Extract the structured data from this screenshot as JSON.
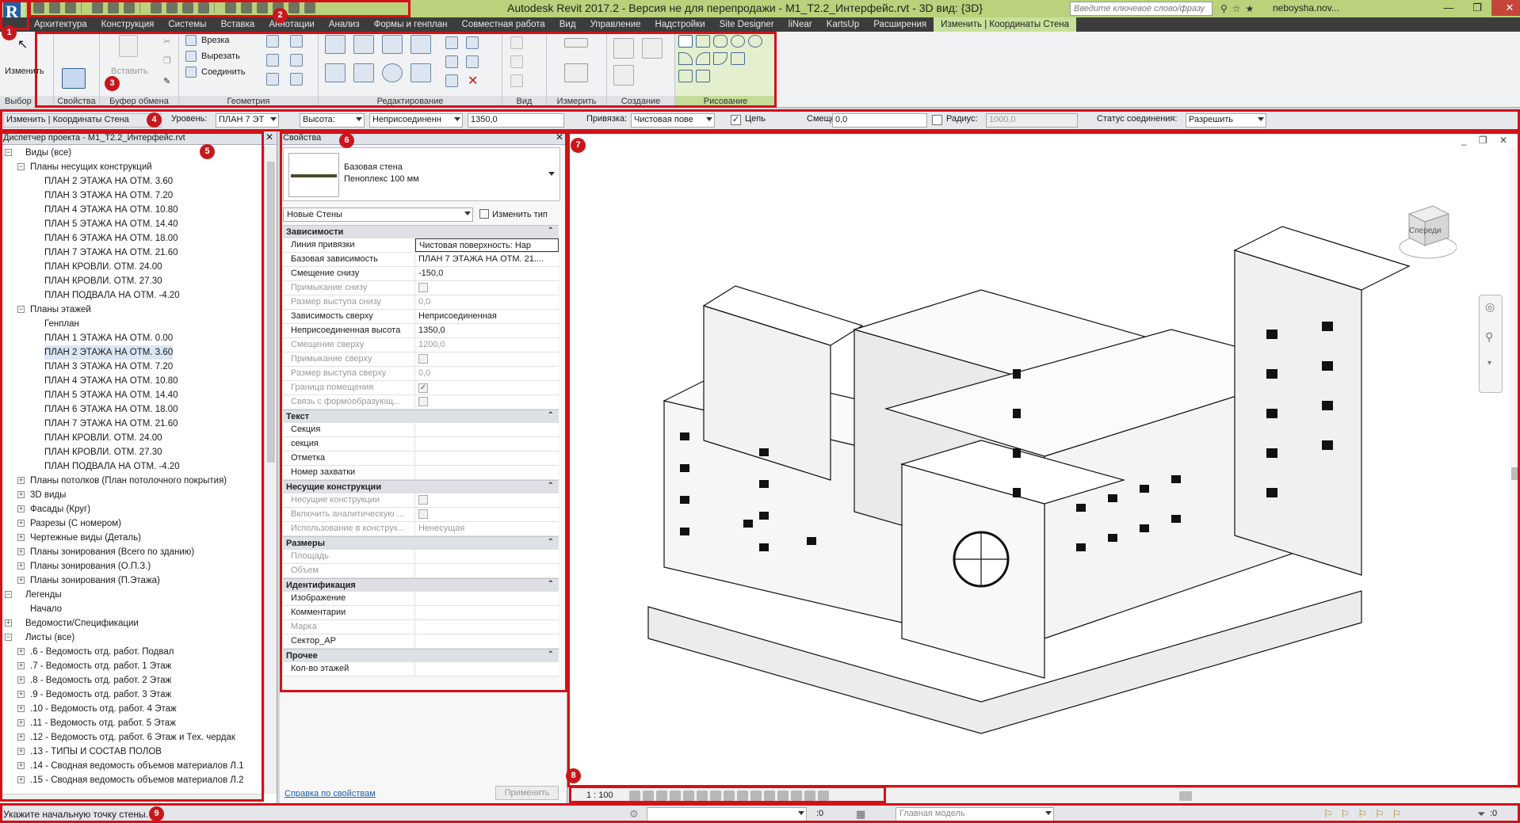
{
  "window": {
    "title": "Autodesk Revit 2017.2 - Версия не для перепродажи -     M1_T2.2_Интерфейс.rvt - 3D вид: {3D}",
    "search_placeholder": "Введите ключевое слово/фразу",
    "user": "neboysha.nov...",
    "min": "—",
    "restore": "❐",
    "close": "✕"
  },
  "ribbon_tabs": [
    "Архитектура",
    "Конструкция",
    "Системы",
    "Вставка",
    "Аннотации",
    "Анализ",
    "Формы и генплан",
    "Совместная работа",
    "Вид",
    "Управление",
    "Надстройки",
    "Site Designer",
    "liNear",
    "KartsUp",
    "Расширения",
    "Изменить | Координаты Стена"
  ],
  "ribbon_active_tab_index": 15,
  "ribbon": {
    "select_label": "Выбор",
    "modify_label": "Изменить",
    "properties_label": "Свойства",
    "clipboard_label": "Буфер обмена",
    "paste_label": "Вставить",
    "geometry_label": "Геометрия",
    "cut_in": "Врезка",
    "cut": "Вырезать",
    "join": "Соединить",
    "edit_label": "Редактирование",
    "view_label": "Вид",
    "measure_label": "Измерить",
    "create_label": "Создание",
    "draw_label": "Рисование"
  },
  "options_bar": {
    "context": "Изменить | Координаты Стена",
    "level_label": "Уровень:",
    "level_value": "ПЛАН 7 ЭТ",
    "height_label": "Высота:",
    "height_mode": "Неприсоединенн",
    "height_value": "1350,0",
    "anchor_label": "Привязка:",
    "anchor_value": "Чистовая пове",
    "chain_label": "Цепь",
    "chain_checked": "✓",
    "offset_label": "Смещение:",
    "offset_value": "0,0",
    "radius_label": "Радиус:",
    "radius_value": "1000,0",
    "join_status_label": "Статус соединения:",
    "join_status_value": "Разрешить"
  },
  "project_browser": {
    "title": "Диспетчер проекта - M1_T2.2_Интерфейс.rvt",
    "close": "✕",
    "nodes": [
      {
        "label": "Виды (все)",
        "depth": 0,
        "toggle": "−"
      },
      {
        "label": "Планы несущих конструкций",
        "depth": 1,
        "toggle": "−"
      },
      {
        "label": "ПЛАН 2 ЭТАЖА НА ОТМ. 3.60",
        "depth": 2,
        "toggle": ""
      },
      {
        "label": "ПЛАН 3 ЭТАЖА НА ОТМ. 7.20",
        "depth": 2,
        "toggle": ""
      },
      {
        "label": "ПЛАН 4 ЭТАЖА НА ОТМ. 10.80",
        "depth": 2,
        "toggle": ""
      },
      {
        "label": "ПЛАН 5 ЭТАЖА НА ОТМ. 14.40",
        "depth": 2,
        "toggle": ""
      },
      {
        "label": "ПЛАН 6 ЭТАЖА НА ОТМ. 18.00",
        "depth": 2,
        "toggle": ""
      },
      {
        "label": "ПЛАН 7 ЭТАЖА НА ОТМ. 21.60",
        "depth": 2,
        "toggle": ""
      },
      {
        "label": "ПЛАН КРОВЛИ. ОТМ. 24.00",
        "depth": 2,
        "toggle": ""
      },
      {
        "label": "ПЛАН КРОВЛИ. ОТМ. 27.30",
        "depth": 2,
        "toggle": ""
      },
      {
        "label": "ПЛАН ПОДВАЛА НА ОТМ. -4.20",
        "depth": 2,
        "toggle": ""
      },
      {
        "label": "Планы этажей",
        "depth": 1,
        "toggle": "−"
      },
      {
        "label": "Генплан",
        "depth": 2,
        "toggle": ""
      },
      {
        "label": "ПЛАН 1 ЭТАЖА НА ОТМ. 0.00",
        "depth": 2,
        "toggle": ""
      },
      {
        "label": "ПЛАН 2 ЭТАЖА НА ОТМ. 3.60",
        "depth": 2,
        "toggle": "",
        "selected": true
      },
      {
        "label": "ПЛАН 3 ЭТАЖА НА ОТМ. 7.20",
        "depth": 2,
        "toggle": ""
      },
      {
        "label": "ПЛАН 4 ЭТАЖА НА ОТМ. 10.80",
        "depth": 2,
        "toggle": ""
      },
      {
        "label": "ПЛАН 5 ЭТАЖА НА ОТМ. 14.40",
        "depth": 2,
        "toggle": ""
      },
      {
        "label": "ПЛАН 6 ЭТАЖА НА ОТМ. 18.00",
        "depth": 2,
        "toggle": ""
      },
      {
        "label": "ПЛАН 7 ЭТАЖА НА ОТМ. 21.60",
        "depth": 2,
        "toggle": ""
      },
      {
        "label": "ПЛАН КРОВЛИ. ОТМ. 24.00",
        "depth": 2,
        "toggle": ""
      },
      {
        "label": "ПЛАН КРОВЛИ. ОТМ. 27.30",
        "depth": 2,
        "toggle": ""
      },
      {
        "label": "ПЛАН ПОДВАЛА НА ОТМ. -4.20",
        "depth": 2,
        "toggle": ""
      },
      {
        "label": "Планы потолков (План потолочного покрытия)",
        "depth": 1,
        "toggle": "+"
      },
      {
        "label": "3D виды",
        "depth": 1,
        "toggle": "+"
      },
      {
        "label": "Фасады (Круг)",
        "depth": 1,
        "toggle": "+"
      },
      {
        "label": "Разрезы (С номером)",
        "depth": 1,
        "toggle": "+"
      },
      {
        "label": "Чертежные виды (Деталь)",
        "depth": 1,
        "toggle": "+"
      },
      {
        "label": "Планы зонирования (Всего по зданию)",
        "depth": 1,
        "toggle": "+"
      },
      {
        "label": "Планы зонирования (О.П.З.)",
        "depth": 1,
        "toggle": "+"
      },
      {
        "label": "Планы зонирования (П.Этажа)",
        "depth": 1,
        "toggle": "+"
      },
      {
        "label": "Легенды",
        "depth": 0,
        "toggle": "−"
      },
      {
        "label": "Начало",
        "depth": 1,
        "toggle": ""
      },
      {
        "label": "Ведомости/Спецификации",
        "depth": 0,
        "toggle": "+"
      },
      {
        "label": "Листы (все)",
        "depth": 0,
        "toggle": "−"
      },
      {
        "label": ".6 - Ведомость отд. работ. Подвал",
        "depth": 1,
        "toggle": "+"
      },
      {
        "label": ".7 - Ведомость отд. работ. 1 Этаж",
        "depth": 1,
        "toggle": "+"
      },
      {
        "label": ".8 - Ведомость отд. работ. 2 Этаж",
        "depth": 1,
        "toggle": "+"
      },
      {
        "label": ".9 - Ведомость отд. работ. 3 Этаж",
        "depth": 1,
        "toggle": "+"
      },
      {
        "label": ".10 - Ведомость отд. работ. 4 Этаж",
        "depth": 1,
        "toggle": "+"
      },
      {
        "label": ".11 - Ведомость отд. работ. 5 Этаж",
        "depth": 1,
        "toggle": "+"
      },
      {
        "label": ".12 - Ведомость отд. работ. 6 Этаж и Тех. чердак",
        "depth": 1,
        "toggle": "+"
      },
      {
        "label": ".13 - ТИПЫ И СОСТАВ ПОЛОВ",
        "depth": 1,
        "toggle": "+"
      },
      {
        "label": ".14 - Сводная ведомость объемов материалов Л.1",
        "depth": 1,
        "toggle": "+"
      },
      {
        "label": ".15 - Сводная ведомость объемов материалов Л.2",
        "depth": 1,
        "toggle": "+"
      }
    ]
  },
  "properties": {
    "title": "Свойства",
    "close": "✕",
    "type_family": "Базовая стена",
    "type_name": "Пеноплекс 100 мм",
    "filter_value": "Новые Стены",
    "edit_type": "Изменить тип",
    "groups": [
      {
        "name": "Зависимости",
        "rows": [
          {
            "k": "Линия привязки",
            "v": "Чистовая поверхность: Нар",
            "ro": false,
            "edit": true
          },
          {
            "k": "Базовая зависимость",
            "v": "ПЛАН 7 ЭТАЖА НА ОТМ. 21....",
            "ro": false
          },
          {
            "k": "Смещение снизу",
            "v": "-150,0",
            "ro": false
          },
          {
            "k": "Примыкание снизу",
            "v": "",
            "ro": true,
            "cb": ""
          },
          {
            "k": "Размер выступа снизу",
            "v": "0,0",
            "ro": true
          },
          {
            "k": "Зависимость сверху",
            "v": "Неприсоединенная",
            "ro": false
          },
          {
            "k": "Неприсоединенная высота",
            "v": "1350,0",
            "ro": false
          },
          {
            "k": "Смещение сверху",
            "v": "1200,0",
            "ro": true
          },
          {
            "k": "Примыкание сверху",
            "v": "",
            "ro": true,
            "cb": ""
          },
          {
            "k": "Размер выступа сверху",
            "v": "0,0",
            "ro": true
          },
          {
            "k": "Граница помещения",
            "v": "",
            "ro": true,
            "cb": "✓"
          },
          {
            "k": "Связь с формообразующ...",
            "v": "",
            "ro": true,
            "cb": ""
          }
        ]
      },
      {
        "name": "Текст",
        "rows": [
          {
            "k": "Секция",
            "v": "",
            "ro": false
          },
          {
            "k": "секция",
            "v": "",
            "ro": false
          },
          {
            "k": "Отметка",
            "v": "",
            "ro": false
          },
          {
            "k": "Номер захватки",
            "v": "",
            "ro": false
          }
        ]
      },
      {
        "name": "Несущие конструкции",
        "rows": [
          {
            "k": "Несущие конструкции",
            "v": "",
            "ro": true,
            "cb": ""
          },
          {
            "k": "Включить аналитическую ...",
            "v": "",
            "ro": true,
            "cb": ""
          },
          {
            "k": "Использование в конструк...",
            "v": "Ненесущая",
            "ro": true
          }
        ]
      },
      {
        "name": "Размеры",
        "rows": [
          {
            "k": "Площадь",
            "v": "",
            "ro": true
          },
          {
            "k": "Объем",
            "v": "",
            "ro": true
          }
        ]
      },
      {
        "name": "Идентификация",
        "rows": [
          {
            "k": "Изображение",
            "v": "",
            "ro": false
          },
          {
            "k": "Комментарии",
            "v": "",
            "ro": false
          },
          {
            "k": "Марка",
            "v": "",
            "ro": true
          },
          {
            "k": "Сектор_АР",
            "v": "",
            "ro": false
          }
        ]
      },
      {
        "name": "Прочее",
        "rows": [
          {
            "k": "Кол-во этажей",
            "v": "",
            "ro": false
          }
        ]
      }
    ],
    "help_link": "Справка по свойствам",
    "apply": "Применить"
  },
  "view": {
    "viewcube_label": "Спереди",
    "scale": "1 : 100",
    "controls": "_ ❐ ✕"
  },
  "status": {
    "message": "Укажите начальную точку стены.",
    "selection_count": ":0",
    "model": "Главная модель",
    "filter_count": ":0"
  },
  "callouts": [
    "1",
    "2",
    "3",
    "4",
    "5",
    "6",
    "7",
    "8",
    "9"
  ],
  "colors": {
    "accent_red": "#d31118",
    "title_green": "#b9d27b",
    "active_tab": "#c6e19a"
  }
}
